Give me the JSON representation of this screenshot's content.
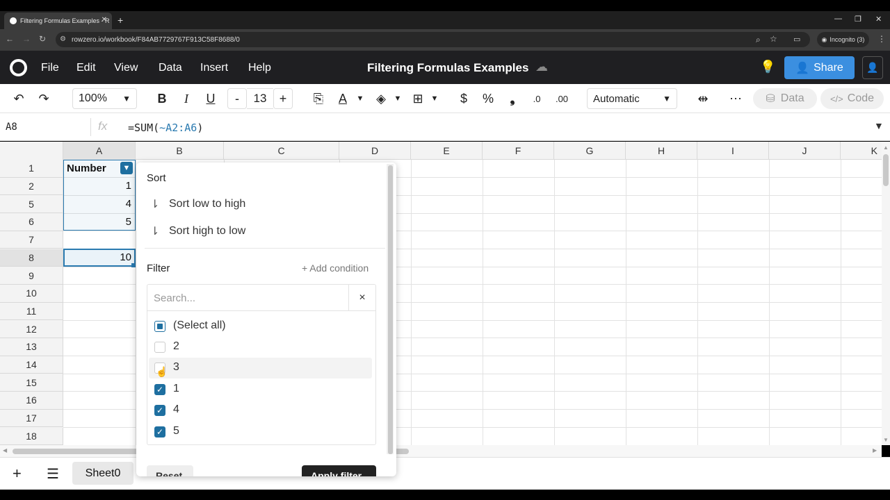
{
  "browser": {
    "tab_title": "Filtering Formulas Examples - R",
    "url": "rowzero.io/workbook/F84AB7729767F913C58F8688/0",
    "incognito": "Incognito (3)"
  },
  "app": {
    "menu": [
      "File",
      "Edit",
      "View",
      "Data",
      "Insert",
      "Help"
    ],
    "doc_title": "Filtering Formulas Examples",
    "share_label": "Share"
  },
  "toolbar": {
    "zoom": "100%",
    "font_size": "13",
    "minus": "-",
    "plus": "+",
    "format": "Automatic",
    "data_label": "Data",
    "code_label": "Code",
    "currency": "$",
    "percent": "%"
  },
  "formula_bar": {
    "cell_ref": "A8",
    "fx": "fx",
    "formula_prefix": "=SUM(",
    "formula_ref": "~A2:A6",
    "formula_suffix": ")"
  },
  "grid": {
    "columns": [
      "A",
      "B",
      "C",
      "D",
      "E",
      "F",
      "G",
      "H",
      "I",
      "J",
      "K"
    ],
    "rows": [
      "1",
      "2",
      "5",
      "6",
      "7",
      "8",
      "9",
      "10",
      "11",
      "12",
      "13",
      "14",
      "15",
      "16",
      "17",
      "18"
    ],
    "cells": {
      "a1": "Number",
      "a2": "1",
      "a5": "4",
      "a6": "5",
      "a8": "10"
    }
  },
  "filter_popup": {
    "sort_heading": "Sort",
    "sort_asc": "Sort low to high",
    "sort_desc": "Sort high to low",
    "filter_heading": "Filter",
    "add_condition": "+ Add condition",
    "search_placeholder": "Search...",
    "clear": "×",
    "options": [
      {
        "label": "(Select all)",
        "state": "partial"
      },
      {
        "label": "2",
        "state": "unchecked"
      },
      {
        "label": "3",
        "state": "unchecked"
      },
      {
        "label": "1",
        "state": "checked"
      },
      {
        "label": "4",
        "state": "checked"
      },
      {
        "label": "5",
        "state": "checked"
      }
    ],
    "reset": "Reset",
    "apply": "Apply filter"
  },
  "sheets": {
    "active": "Sheet0"
  },
  "colors": {
    "accent": "#1e6fa0",
    "share": "#3b8fe0",
    "header_bg": "#1f1f22"
  }
}
